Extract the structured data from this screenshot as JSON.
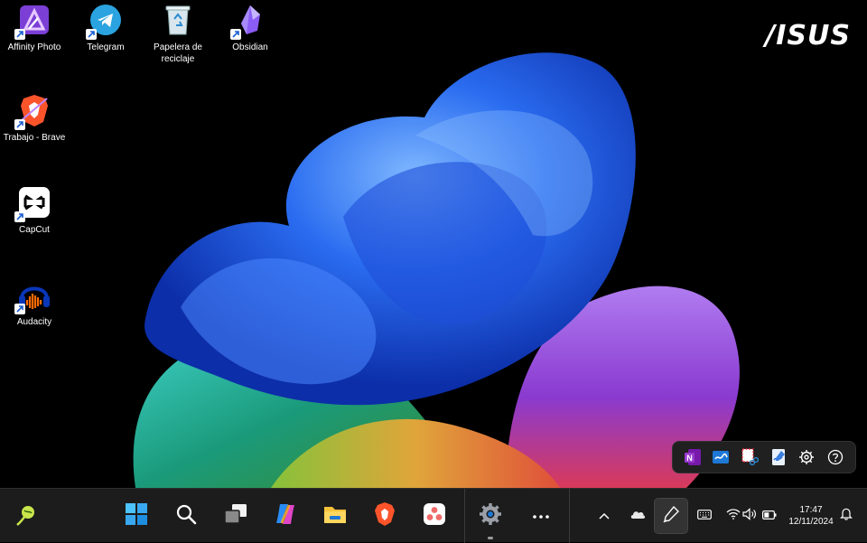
{
  "desktop": {
    "brand": "/ISUS",
    "icons": [
      {
        "label": "Affinity Photo",
        "icon": "affinity-photo-icon"
      },
      {
        "label": "Telegram",
        "icon": "telegram-icon"
      },
      {
        "label": "Papelera de reciclaje",
        "icon": "recycle-bin-icon"
      },
      {
        "label": "Obsidian",
        "icon": "obsidian-icon"
      },
      {
        "label": "Trabajo - Brave",
        "icon": "brave-icon"
      },
      {
        "label": "CapCut",
        "icon": "capcut-icon"
      },
      {
        "label": "Audacity",
        "icon": "audacity-icon"
      }
    ]
  },
  "pen_tray": {
    "items": [
      "onenote-icon",
      "whiteboard-icon",
      "snipping-tool-icon",
      "journal-icon",
      "gear-icon",
      "help-icon"
    ]
  },
  "taskbar": {
    "left_widget": "widgets-icon",
    "pinned": [
      "start-icon",
      "search-icon",
      "task-view-icon",
      "copilot-icon",
      "file-explorer-icon",
      "brave-icon",
      "asana-icon",
      "settings-icon",
      "more-icon"
    ],
    "tray": [
      "chevron-up-icon",
      "onedrive-icon",
      "pen-icon",
      "keyboard-icon",
      "wifi-icon",
      "volume-icon",
      "battery-icon",
      "notifications-icon"
    ],
    "clock": {
      "time": "17:47",
      "date": "12/11/2024"
    }
  },
  "colors": {
    "taskbar_bg": "#1c1c1c",
    "accent": "#0078d4"
  }
}
